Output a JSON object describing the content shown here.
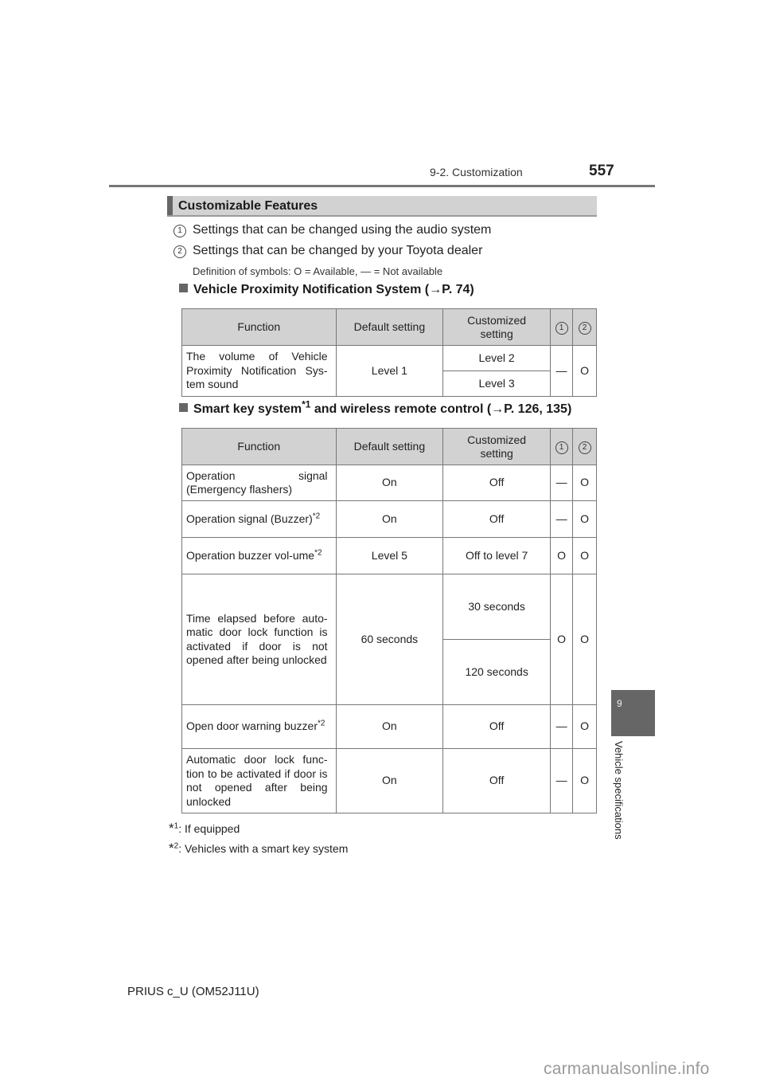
{
  "header": {
    "section": "9-2. Customization",
    "page_number": "557"
  },
  "banner": {
    "title": "Customizable Features"
  },
  "legend": [
    {
      "marker": "1",
      "text": "Settings that can be changed using the audio system"
    },
    {
      "marker": "2",
      "text": "Settings that can be changed by your Toyota dealer"
    }
  ],
  "definition": "Definition of symbols: O = Available, — = Not available",
  "table_headers": {
    "function": "Function",
    "default": "Default setting",
    "custom": "Customized setting",
    "col1": "1",
    "col2": "2"
  },
  "section1": {
    "title": "Vehicle Proximity Notification System (→P. 74)",
    "rows": [
      {
        "function": "The volume of Vehicle Proximity Notification Sys-tem sound",
        "default": "Level 1",
        "custom": [
          "Level 2",
          "Level 3"
        ],
        "c1": "—",
        "c2": "O"
      }
    ]
  },
  "section2": {
    "title_pre": "Smart key system",
    "title_sup": "*1",
    "title_post": " and wireless remote control (→P. 126, 135)",
    "rows": [
      {
        "function": "Operation signal (Emergency flashers)",
        "sup": "",
        "default": "On",
        "custom": "Off",
        "c1": "—",
        "c2": "O"
      },
      {
        "function": "Operation signal (Buzzer)",
        "sup": "*2",
        "default": "On",
        "custom": "Off",
        "c1": "—",
        "c2": "O"
      },
      {
        "function": "Operation buzzer vol-ume",
        "sup": "*2",
        "default": "Level 5",
        "custom": "Off to level 7",
        "c1": "O",
        "c2": "O"
      },
      {
        "function": "Time elapsed before auto-matic door lock function is activated if door is not opened after being unlocked",
        "sup": "",
        "default": "60 seconds",
        "custom": [
          "30 seconds",
          "120 seconds"
        ],
        "c1": "O",
        "c2": "O"
      },
      {
        "function": "Open door warning buzzer",
        "sup": "*2",
        "default": "On",
        "custom": "Off",
        "c1": "—",
        "c2": "O"
      },
      {
        "function": "Automatic door lock func-tion to be activated if door is not opened after being unlocked",
        "sup": "",
        "default": "On",
        "custom": "Off",
        "c1": "—",
        "c2": "O"
      }
    ]
  },
  "footnotes": [
    {
      "mark": "*",
      "num": "1",
      "text": ": If equipped"
    },
    {
      "mark": "*",
      "num": "2",
      "text": ": Vehicles with a smart key system"
    }
  ],
  "side_tab": {
    "number": "9",
    "label": "Vehicle specifications"
  },
  "footer": {
    "model": "PRIUS c_U (OM52J11U)",
    "watermark": "carmanualsonline.info"
  }
}
